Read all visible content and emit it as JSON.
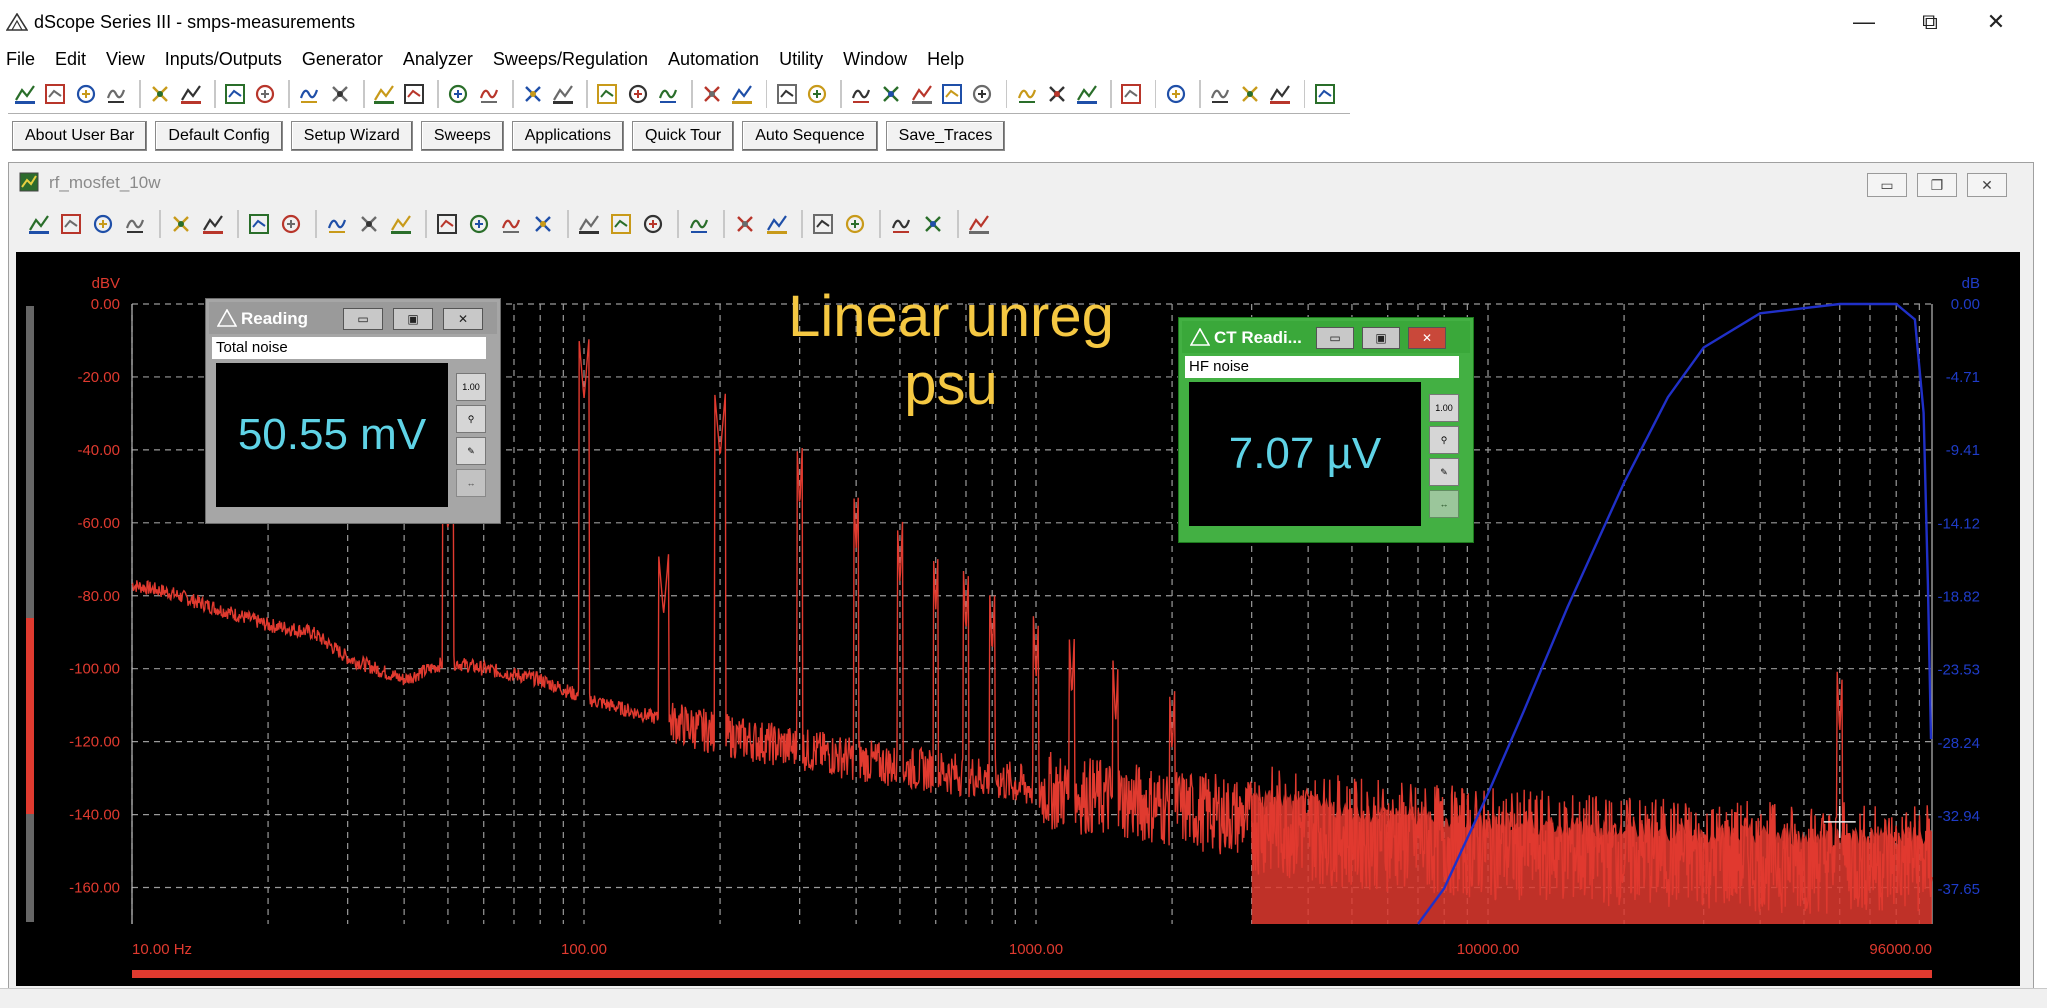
{
  "window": {
    "title": "dScope Series III - smps-measurements",
    "minimize_glyph": "—",
    "restore_glyph": "⧉",
    "close_glyph": "✕"
  },
  "menu": [
    "File",
    "Edit",
    "View",
    "Inputs/Outputs",
    "Generator",
    "Analyzer",
    "Sweeps/Regulation",
    "Automation",
    "Utility",
    "Window",
    "Help"
  ],
  "toolbar_icons": [
    "open-icon",
    "dropdown-icon",
    "save-icon",
    "save-config-icon",
    "gen-out-a-icon",
    "gen-out-b-icon",
    "gen-off-a-icon",
    "gen-off-b-icon",
    "analyzer-in-a-icon",
    "analyzer-in-b-icon",
    "headphone-icon",
    "mute-icon",
    "wave-a-icon",
    "wave-b-icon",
    "scope-icon",
    "scope-settings-icon",
    "measure-a-icon",
    "measure-b-icon",
    "measure-c-icon",
    "run-green-icon",
    "stop-red-icon",
    "sweep-icon",
    "regulate-icon",
    "filter-a-icon",
    "filter-b-icon",
    "filter-c-icon",
    "filter-d-icon",
    "filter-e-icon",
    "fft-icon",
    "trace-a-icon",
    "trace-b-icon",
    "trace-c-icon",
    "timer-icon",
    "report-icon",
    "dropdown-icon-2",
    "report-b-icon",
    "help-icon"
  ],
  "userbar": [
    "About User Bar",
    "Default Config",
    "Setup Wizard",
    "Sweeps",
    "Applications",
    "Quick Tour",
    "Auto Sequence",
    "Save_Traces"
  ],
  "mdi": {
    "title": "rf_mosfet_10w",
    "toolbar_icons": [
      "add-trace-icon",
      "trace-wave-icon",
      "trace-save-icon",
      "trace-copy-icon",
      "graph-a-icon",
      "graph-b-icon",
      "table-icon",
      "scale-icon",
      "cursor-a-icon",
      "cursor-b-icon",
      "marker-icon",
      "peak-icon",
      "peak-b-icon",
      "peak-c-icon",
      "peak-d-icon",
      "zoom-a-icon",
      "zoom-b-icon",
      "zoom-c-icon",
      "autoscale-icon",
      "lin-icon",
      "log-icon",
      "grid-icon",
      "overlay-icon",
      "smooth-icon",
      "avg-icon",
      "export-icon"
    ]
  },
  "reading": {
    "title": "Reading",
    "label": "Total noise",
    "value": "50.55 mV"
  },
  "ct_reading": {
    "title": "CT Readi...",
    "label": "HF noise",
    "value": "7.07 µV"
  },
  "chart_data": {
    "type": "line",
    "title": "Linear unreg psu",
    "title_lines": [
      "Linear unreg",
      "psu"
    ],
    "xlabel": "",
    "ylabel_left": "dBV",
    "ylabel_right": "dB",
    "x_scale": "log",
    "xlim": [
      10,
      96000
    ],
    "ylim_left": [
      -170,
      0
    ],
    "ylim_right": [
      -39.9,
      0
    ],
    "x_tick_labels": [
      "10.00 Hz",
      "100.00",
      "1000.00",
      "10000.00",
      "96000.00"
    ],
    "y_left_ticks": [
      "0.00",
      "-20.00",
      "-40.00",
      "-60.00",
      "-80.00",
      "-100.00",
      "-120.00",
      "-140.00",
      "-160.00"
    ],
    "y_right_ticks": [
      "0.00",
      "-4.71",
      "-9.41",
      "-14.12",
      "-18.82",
      "-23.53",
      "-28.24",
      "-32.94",
      "-37.65"
    ],
    "grid": true,
    "colors": {
      "background": "#000000",
      "grid": "#9a9a9a",
      "left_axis": "#e03a2f",
      "right_axis": "#1f3cc8",
      "title": "#f5c842",
      "noise": "#e03a2f",
      "filter": "#2030c8"
    },
    "series": [
      {
        "axis": "left",
        "envelope": "noise-floor",
        "x": [
          10,
          12,
          15,
          20,
          25,
          30,
          40,
          50,
          60,
          80,
          100,
          130,
          200,
          300,
          500,
          800,
          1000,
          2000,
          5000,
          10000,
          20000,
          50000,
          96000
        ],
        "y": [
          -77,
          -79,
          -83,
          -88,
          -90,
          -97,
          -103,
          -98,
          -100,
          -103,
          -108,
          -112,
          -118,
          -122,
          -127,
          -130,
          -133,
          -138,
          -145,
          -148,
          -150,
          -152,
          -152
        ],
        "harmonics": [
          {
            "x": 50,
            "y": -62
          },
          {
            "x": 100,
            "y": -26
          },
          {
            "x": 150,
            "y": -85
          },
          {
            "x": 200,
            "y": -42
          },
          {
            "x": 300,
            "y": -56
          },
          {
            "x": 400,
            "y": -67
          },
          {
            "x": 500,
            "y": -77
          },
          {
            "x": 600,
            "y": -84
          },
          {
            "x": 700,
            "y": -90
          },
          {
            "x": 800,
            "y": -96
          },
          {
            "x": 1000,
            "y": -103
          },
          {
            "x": 1200,
            "y": -108
          },
          {
            "x": 1500,
            "y": -115
          },
          {
            "x": 2000,
            "y": -123
          },
          {
            "x": 60000,
            "y": -118
          }
        ]
      },
      {
        "axis": "right",
        "envelope": "bandpass-filter",
        "x": [
          7000,
          8000,
          10000,
          12000,
          15000,
          20000,
          25000,
          30000,
          40000,
          60000,
          80000,
          88000,
          92000,
          94000,
          95500
        ],
        "y": [
          -39.9,
          -37.6,
          -31.5,
          -26.2,
          -19.5,
          -11.5,
          -6.0,
          -2.8,
          -0.6,
          0.0,
          0.0,
          -1.0,
          -7.0,
          -18.0,
          -28.0
        ]
      }
    ]
  }
}
